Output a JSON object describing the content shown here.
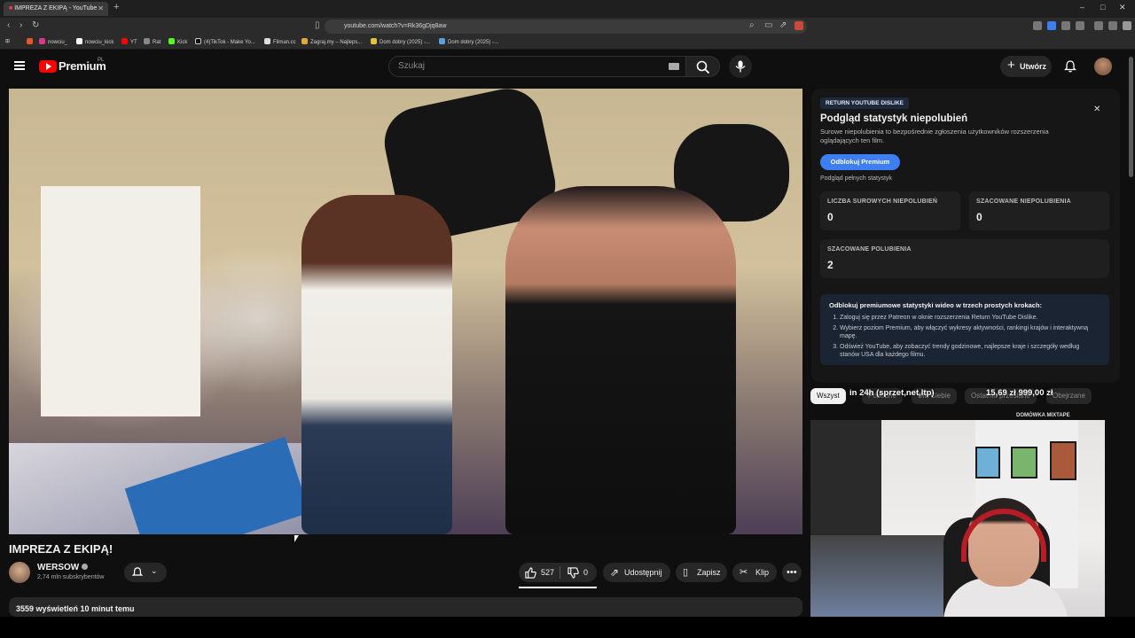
{
  "browser": {
    "tab_title": "IMPREZA Z EKIPĄ - YouTube",
    "url": "youtube.com/watch?v=Rk36gDjq8aw",
    "bookmarks": [
      "nowciu_",
      "nowciu_kick",
      "YT",
      "Rat",
      "Kick",
      "(4)TikTok - Make Yo...",
      "Filman.cc",
      "Zagraj.my – Najleps...",
      "Dom dobry (2025) -...",
      "Dom dobry (2025) -..."
    ]
  },
  "header": {
    "brand": "Premium",
    "brand_region": "PL",
    "search_placeholder": "Szukaj",
    "create_label": "Utwórz"
  },
  "video": {
    "title": "IMPREZA Z EKIPĄ!",
    "channel": "WERSOW",
    "subscribers": "2,74 mln subskrybentów",
    "likes": "527",
    "dislikes": "0",
    "share_label": "Udostępnij",
    "save_label": "Zapisz",
    "clip_label": "Klip",
    "views_time": "3559 wyświetleń  10 minut temu"
  },
  "ryd": {
    "badge": "RETURN YOUTUBE DISLIKE",
    "heading": "Podgląd statystyk niepolubień",
    "subtitle": "Surowe niepolubienia to bezpośrednie zgłoszenia użytkowników rozszerzenia oglądających ten film.",
    "unlock_button": "Odblokuj Premium",
    "full_stats_link": "Podgląd pełnych statystyk",
    "stats": [
      {
        "label": "LICZBA SUROWYCH NIEPOLUBIEŃ",
        "value": "0"
      },
      {
        "label": "SZACOWANE NIEPOLUBIENIA",
        "value": "0"
      },
      {
        "label": "SZACOWANE POLUBIENIA",
        "value": "2"
      }
    ],
    "unlock_heading": "Odblokuj premiumowe statystyki wideo w trzech prostych krokach:",
    "steps": [
      "Zaloguj się przez Patreon w oknie rozszerzenia Return YouTube Dislike.",
      "Wybierz poziom Premium, aby włączyć wykresy aktywności, rankingi krajów i interaktywną mapę.",
      "Odśwież YouTube, aby zobaczyć trendy godzinowe, najlepsze kraje i szczegóły według stanów USA dla każdego filmu."
    ]
  },
  "chips": {
    "active": "Wszyst",
    "others": [
      "Podobne",
      "Dla Ciebie",
      "Ostatnio przesłane",
      "Obejrzane"
    ]
  },
  "stream_overlay": {
    "left": "in 24h (sprzet,net,ltp)",
    "right": "15,69 zł  999,00 zł"
  },
  "next_title": "DOMÓWKA MIXTAPE",
  "colors": {
    "background": "#0f0f0f",
    "brand_red": "#ff0000",
    "premium_button": "#3d7ef2"
  }
}
